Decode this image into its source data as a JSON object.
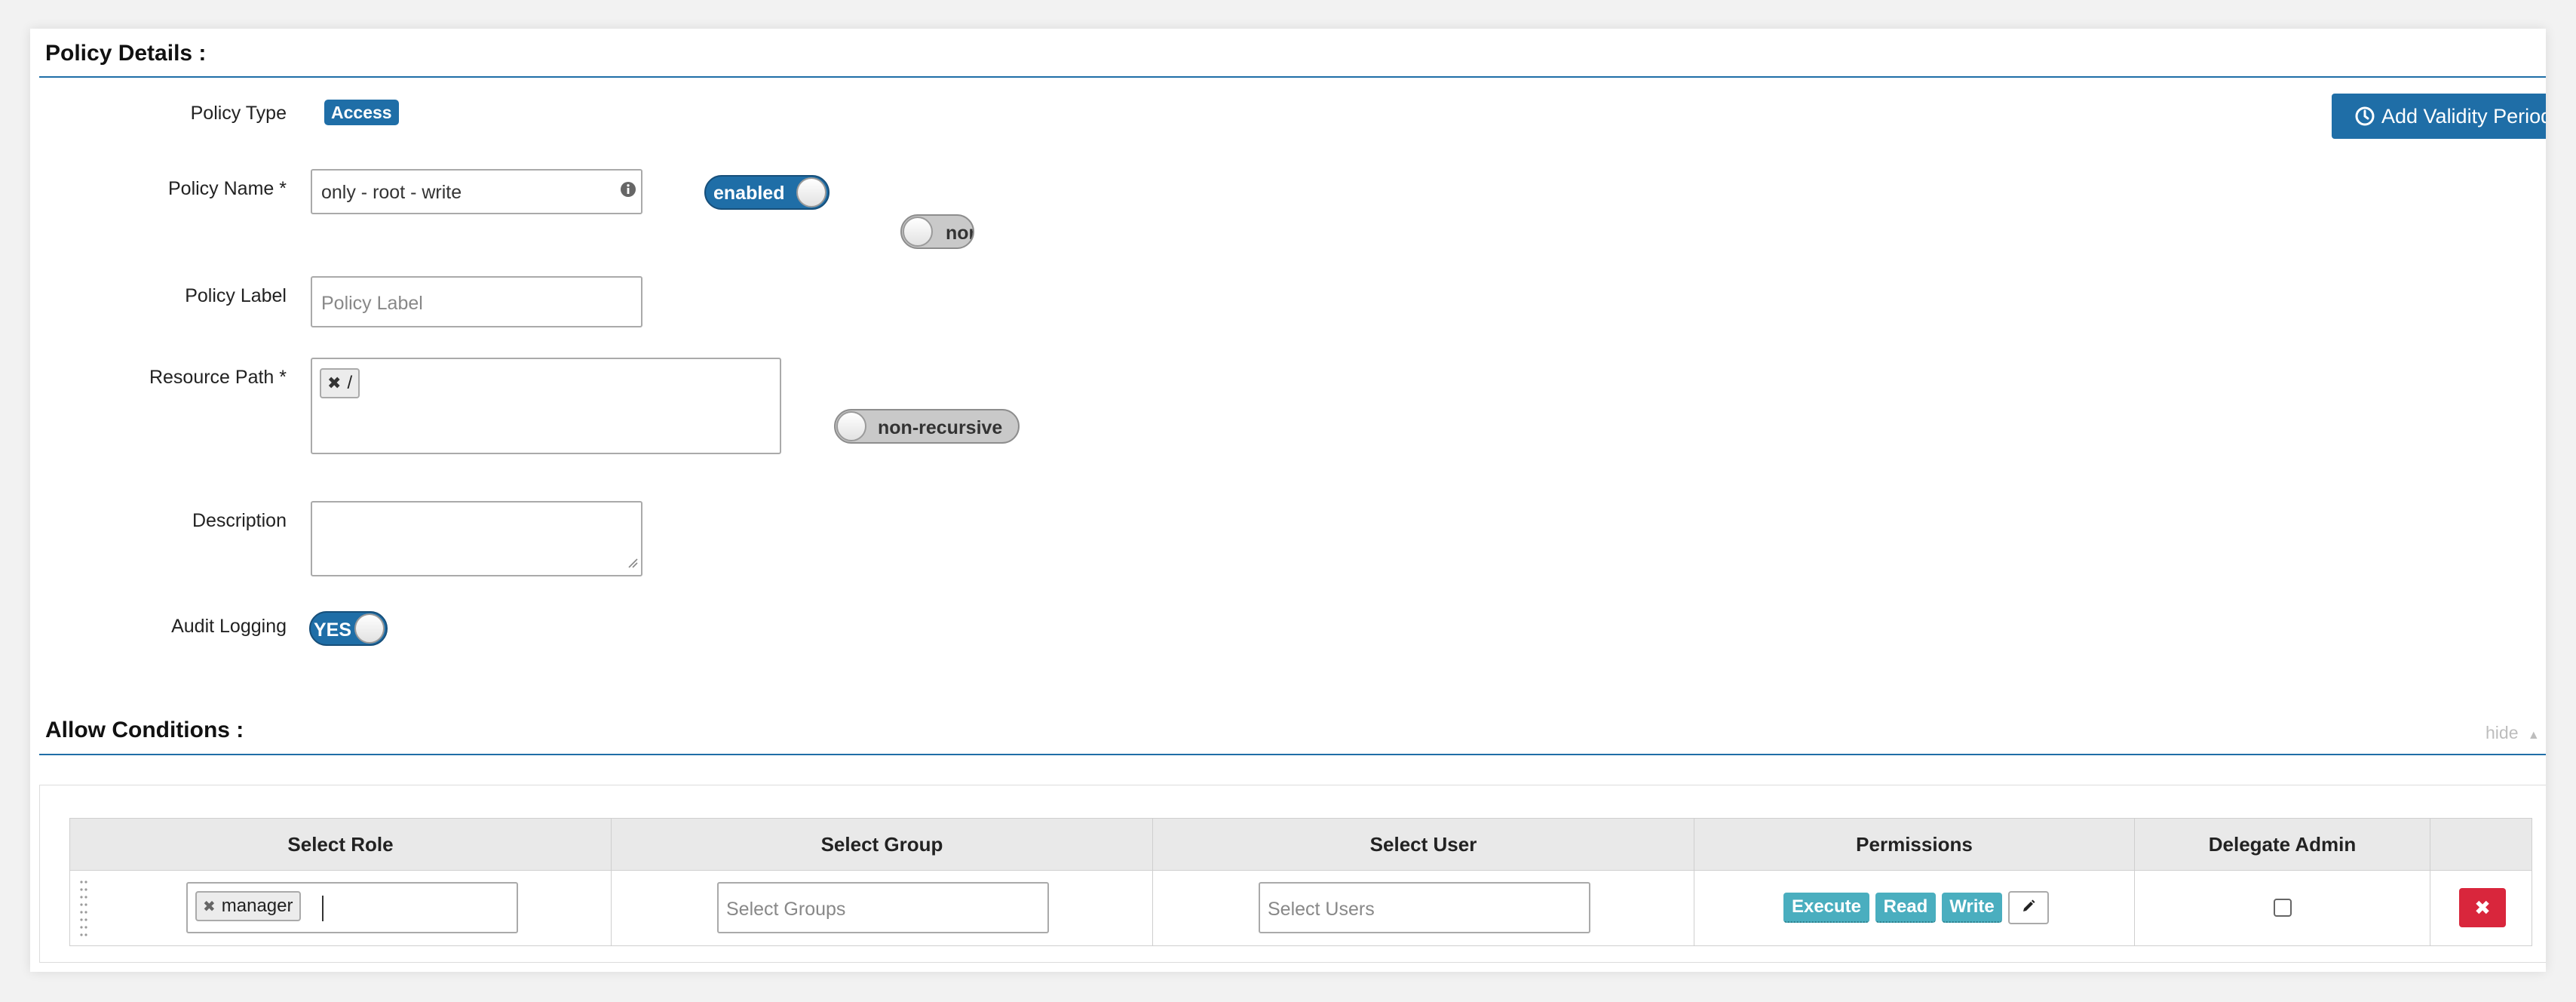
{
  "colors": {
    "brand_blue": "#1f6ea7",
    "permission_teal": "#4aaebf",
    "danger_red": "#d9263c"
  },
  "policy_details": {
    "title": "Policy Details :",
    "add_validity_label": "Add Validity Period",
    "policy_type": {
      "label": "Policy Type",
      "value": "Access"
    },
    "policy_name": {
      "label": "Policy Name *",
      "value": "only - root - write",
      "enabled_toggle": "enabled",
      "override_toggle": "nor"
    },
    "policy_label": {
      "label": "Policy Label",
      "placeholder": "Policy Label"
    },
    "resource_path": {
      "label": "Resource Path *",
      "tags": [
        "/"
      ],
      "recursive_toggle": "non-recursive"
    },
    "description": {
      "label": "Description",
      "value": ""
    },
    "audit_logging": {
      "label": "Audit Logging",
      "toggle": "YES"
    }
  },
  "allow_conditions": {
    "title": "Allow Conditions :",
    "hide_label": "hide",
    "columns": [
      "Select Role",
      "Select Group",
      "Select User",
      "Permissions",
      "Delegate Admin"
    ],
    "row": {
      "roles": [
        "manager"
      ],
      "groups_placeholder": "Select Groups",
      "users_placeholder": "Select Users",
      "permissions": [
        "Execute",
        "Read",
        "Write"
      ],
      "delegate_admin": false
    }
  }
}
